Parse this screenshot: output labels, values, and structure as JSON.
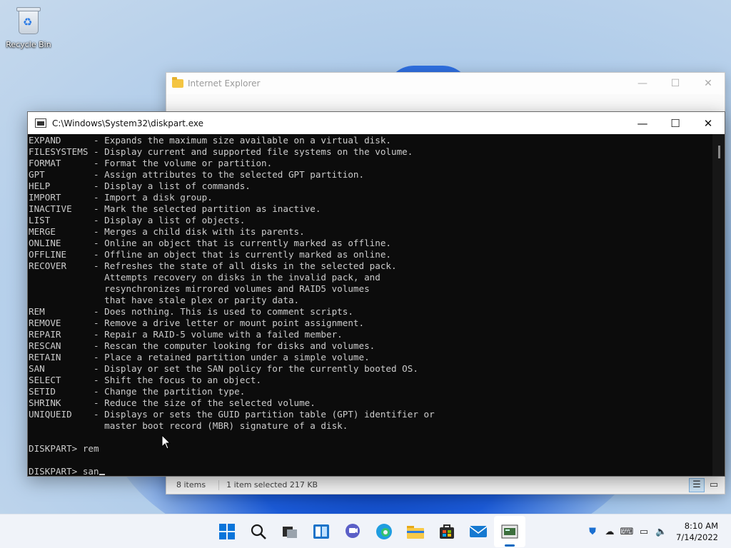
{
  "desktop": {
    "icons": [
      {
        "label": "Recycle Bin",
        "icon": "recycle-bin-icon"
      }
    ]
  },
  "explorer": {
    "title": "Internet Explorer",
    "status": {
      "items": "8 items",
      "selected": "1 item selected  217 KB"
    }
  },
  "console": {
    "title": "C:\\Windows\\System32\\diskpart.exe",
    "lines": [
      "EXPAND      - Expands the maximum size available on a virtual disk.",
      "FILESYSTEMS - Display current and supported file systems on the volume.",
      "FORMAT      - Format the volume or partition.",
      "GPT         - Assign attributes to the selected GPT partition.",
      "HELP        - Display a list of commands.",
      "IMPORT      - Import a disk group.",
      "INACTIVE    - Mark the selected partition as inactive.",
      "LIST        - Display a list of objects.",
      "MERGE       - Merges a child disk with its parents.",
      "ONLINE      - Online an object that is currently marked as offline.",
      "OFFLINE     - Offline an object that is currently marked as online.",
      "RECOVER     - Refreshes the state of all disks in the selected pack.",
      "              Attempts recovery on disks in the invalid pack, and",
      "              resynchronizes mirrored volumes and RAID5 volumes",
      "              that have stale plex or parity data.",
      "REM         - Does nothing. This is used to comment scripts.",
      "REMOVE      - Remove a drive letter or mount point assignment.",
      "REPAIR      - Repair a RAID-5 volume with a failed member.",
      "RESCAN      - Rescan the computer looking for disks and volumes.",
      "RETAIN      - Place a retained partition under a simple volume.",
      "SAN         - Display or set the SAN policy for the currently booted OS.",
      "SELECT      - Shift the focus to an object.",
      "SETID       - Change the partition type.",
      "SHRINK      - Reduce the size of the selected volume.",
      "UNIQUEID    - Displays or sets the GUID partition table (GPT) identifier or",
      "              master boot record (MBR) signature of a disk.",
      "",
      "DISKPART> rem",
      "",
      "DISKPART> san"
    ]
  },
  "taskbar": {
    "apps": [
      {
        "name": "start-button",
        "icon": "windows-logo-icon"
      },
      {
        "name": "search-button",
        "icon": "search-icon"
      },
      {
        "name": "task-view-button",
        "icon": "task-view-icon"
      },
      {
        "name": "widgets-button",
        "icon": "widgets-icon"
      },
      {
        "name": "chat-button",
        "icon": "chat-icon"
      },
      {
        "name": "edge-button",
        "icon": "edge-icon"
      },
      {
        "name": "file-explorer-button",
        "icon": "folder-icon"
      },
      {
        "name": "store-button",
        "icon": "store-icon"
      },
      {
        "name": "mail-button",
        "icon": "mail-icon"
      },
      {
        "name": "diskpart-button",
        "icon": "console-icon"
      }
    ],
    "clock": {
      "time": "8:10 AM",
      "date": "7/14/2022"
    }
  }
}
